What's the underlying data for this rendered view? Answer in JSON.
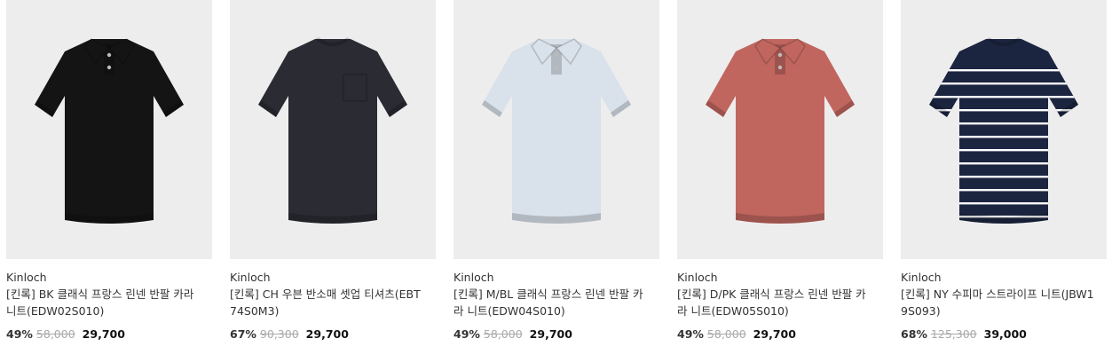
{
  "products": [
    {
      "brand": "Kinloch",
      "name": "[킨록] BK 클래식 프랑스 린넨 반팔 카라 니트(EDW02S010)",
      "discount": "49%",
      "original_price": "58,000",
      "sale_price": "29,700",
      "shirt": {
        "type": "polo",
        "color": "#141414",
        "stripes": false
      }
    },
    {
      "brand": "Kinloch",
      "name": "[킨록] CH 우븐 반소매 셋업 티셔츠(EBT74S0M3)",
      "discount": "67%",
      "original_price": "90,300",
      "sale_price": "29,700",
      "shirt": {
        "type": "tee",
        "color": "#2a2b33",
        "stripes": false
      }
    },
    {
      "brand": "Kinloch",
      "name": "[킨록] M/BL 클래식 프랑스 린넨 반팔 카라 니트(EDW04S010)",
      "discount": "49%",
      "original_price": "58,000",
      "sale_price": "29,700",
      "shirt": {
        "type": "polo",
        "color": "#d9e1ea",
        "stripes": false
      }
    },
    {
      "brand": "Kinloch",
      "name": "[킨록] D/PK 클래식 프랑스 린넨 반팔 카라 니트(EDW05S010)",
      "discount": "49%",
      "original_price": "58,000",
      "sale_price": "29,700",
      "shirt": {
        "type": "polo",
        "color": "#c0665f",
        "stripes": false
      }
    },
    {
      "brand": "Kinloch",
      "name": "[킨록] NY 수피마 스트라이프 니트(JBW19S093)",
      "discount": "68%",
      "original_price": "125,300",
      "sale_price": "39,000",
      "shirt": {
        "type": "tee",
        "color": "#1c2540",
        "stripes": true,
        "stripe_color": "#ffffff"
      }
    }
  ]
}
